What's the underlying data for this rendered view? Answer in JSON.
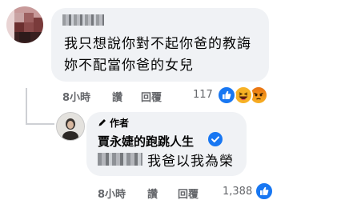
{
  "comment": {
    "lines": [
      "我只想說你對不起你爸的教誨",
      "妳不配當你爸的女兒"
    ],
    "time": "8小時",
    "like_action": "讚",
    "reply_action": "回覆",
    "reaction_count": "117",
    "reactions": [
      "like-icon",
      "haha-icon",
      "angry-icon"
    ]
  },
  "reply": {
    "author_badge": "作者",
    "author_name": "賈永婕的跑跳人生",
    "text": "我爸以我為榮",
    "time": "8小時",
    "like_action": "讚",
    "reply_action": "回覆",
    "reaction_count": "1,388",
    "reactions": [
      "like-icon"
    ]
  },
  "colors": {
    "bubble": "#f0f2f5",
    "facebook_blue": "#1877f2",
    "meta_text": "#65676b"
  }
}
